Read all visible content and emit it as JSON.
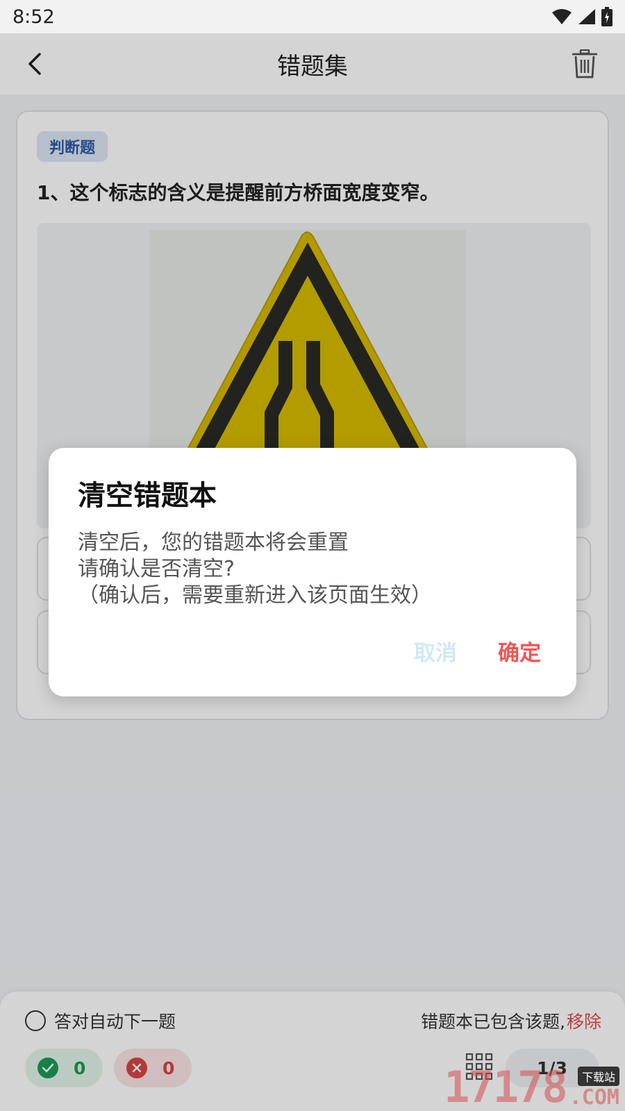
{
  "status_bar": {
    "time": "8:52"
  },
  "app_bar": {
    "title": "错题集"
  },
  "question_card": {
    "type_tag": "判断题",
    "question_text": "1、这个标志的含义是提醒前方桥面宽度变窄。"
  },
  "bottom_bar": {
    "auto_next_label": "答对自动下一题",
    "contains_text": "错题本已包含该题,",
    "remove_link": "移除",
    "correct_count": "0",
    "wrong_count": "0",
    "pager": "1/3"
  },
  "dialog": {
    "title": "清空错题本",
    "body_lines": [
      "清空后，您的错题本将会重置",
      "请确认是否清空?",
      "（确认后，需要重新进入该页面生效）"
    ],
    "cancel_label": "取消",
    "confirm_label": "确定"
  },
  "watermark": {
    "number": "17178",
    "tag": "下载站",
    "suffix": ".COM"
  },
  "colors": {
    "accent_red": "#f05454",
    "correct_green": "#1a9c58",
    "wrong_red": "#d64545",
    "tag_blue": "#2e5aa5"
  },
  "icons": [
    "back-arrow-icon",
    "trash-icon",
    "wifi-icon",
    "signal-icon",
    "battery-icon",
    "check-icon",
    "cross-icon",
    "grid-icon",
    "warning-sign-image"
  ]
}
